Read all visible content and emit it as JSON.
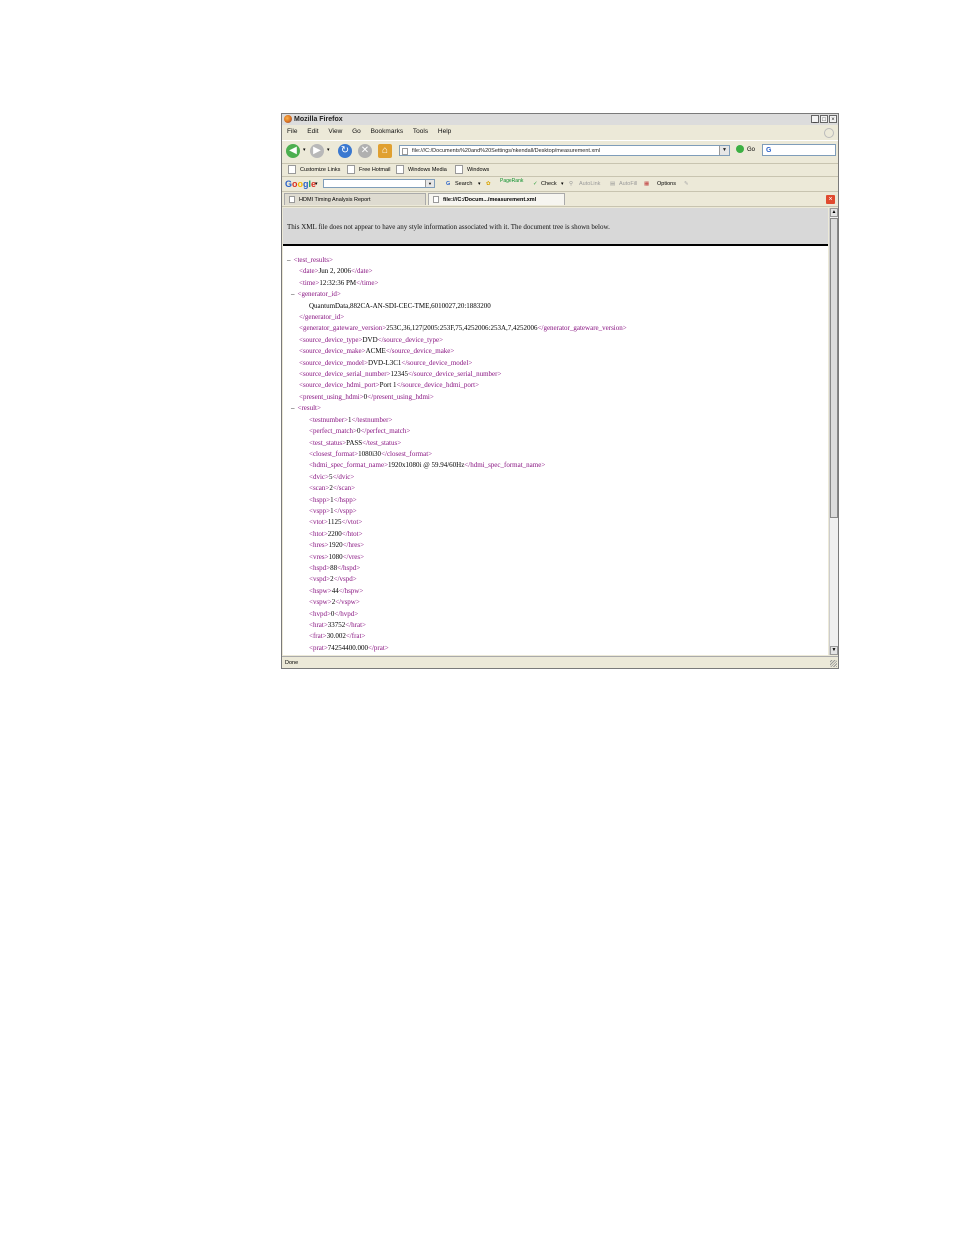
{
  "window": {
    "title": "Mozilla Firefox",
    "controls": [
      "_",
      "□",
      "×"
    ]
  },
  "menu": [
    "File",
    "Edit",
    "View",
    "Go",
    "Bookmarks",
    "Tools",
    "Help"
  ],
  "nav": {
    "url": "file:///C:/Documents%20and%20Settings/nkendall/Desktop/measurement.xml",
    "go_label": "Go",
    "search_value": "G"
  },
  "bookmarks": [
    "Customize Links",
    "Free Hotmail",
    "Windows Media",
    "Windows"
  ],
  "google_toolbar": {
    "logo": "Google",
    "search_label": "Search",
    "pagerank_label": "PageRank",
    "check_label": "Check",
    "autolink_label": "AutoLink",
    "autofill_label": "AutoFill",
    "options_label": "Options"
  },
  "tabs": [
    {
      "label": "HDMI Timing Analysis Report"
    },
    {
      "label": "file:///C:/Docum.../measurement.xml"
    }
  ],
  "notice": "This XML file does not appear to have any style information associated with it. The document tree is shown below.",
  "xml": {
    "root_open": "<test_results>",
    "date": "Jun 2, 2006",
    "time": "12:32:36 PM",
    "generator_open": "<generator_id>",
    "generator_value": "QuantumData,882CA-AN-SDI-CEC-TME,6010027,20:1883200",
    "generator_close": "</generator_id>",
    "generator_gateware_version": "253C,36,127|2005:253F,75,4252006:253A,7,4252006",
    "source_device_type": "DVD",
    "source_device_make": "ACME",
    "source_device_model": "DVD-L3C1",
    "source_device_serial_number": "12345",
    "source_device_hdmi_port": "Port 1",
    "present_using_hdmi": "0",
    "result_open": "<result>",
    "testnumber": "1",
    "perfect_match": "0",
    "test_status": "PASS",
    "closest_format": "1080i30",
    "hdmi_spec_format_name": "1920x1080i @ 59.94/60Hz",
    "dvic": "5",
    "scan": "2",
    "hspp": "1",
    "vspp": "1",
    "vtot": "1125",
    "htot": "2200",
    "hres": "1920",
    "vres": "1080",
    "hspd": "88",
    "vspd": "2",
    "hspw": "44",
    "vspw": "2",
    "hvpd": "0",
    "hrat": "33752",
    "frat": "30.002",
    "prat": "74254400.000"
  },
  "status": "Done"
}
